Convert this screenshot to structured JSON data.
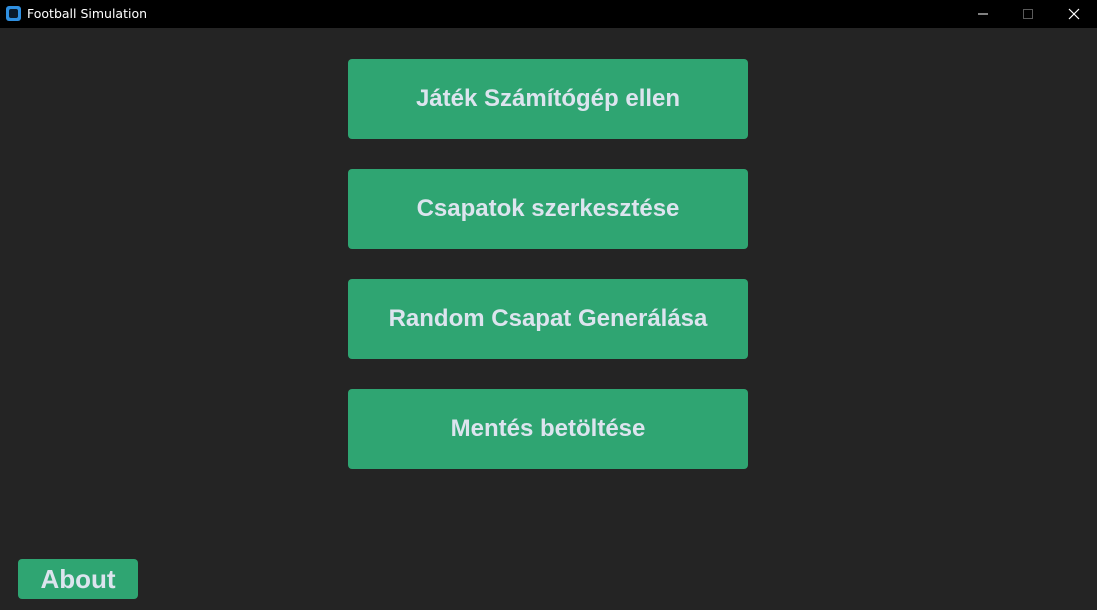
{
  "window": {
    "title": "Football Simulation",
    "icon": "app-icon"
  },
  "controls": {
    "minimize_icon": "minimize-icon",
    "maximize_icon": "maximize-icon",
    "close_icon": "close-icon"
  },
  "menu": {
    "buttons": [
      {
        "label": "Játék Számítógép ellen"
      },
      {
        "label": "Csapatok szerkesztése"
      },
      {
        "label": "Random Csapat Generálása"
      },
      {
        "label": "Mentés betöltése"
      }
    ]
  },
  "about": {
    "label": "About"
  },
  "colors": {
    "background": "#242424",
    "titlebar": "#000000",
    "button": "#2fa572",
    "button_text": "#dce4ee"
  }
}
